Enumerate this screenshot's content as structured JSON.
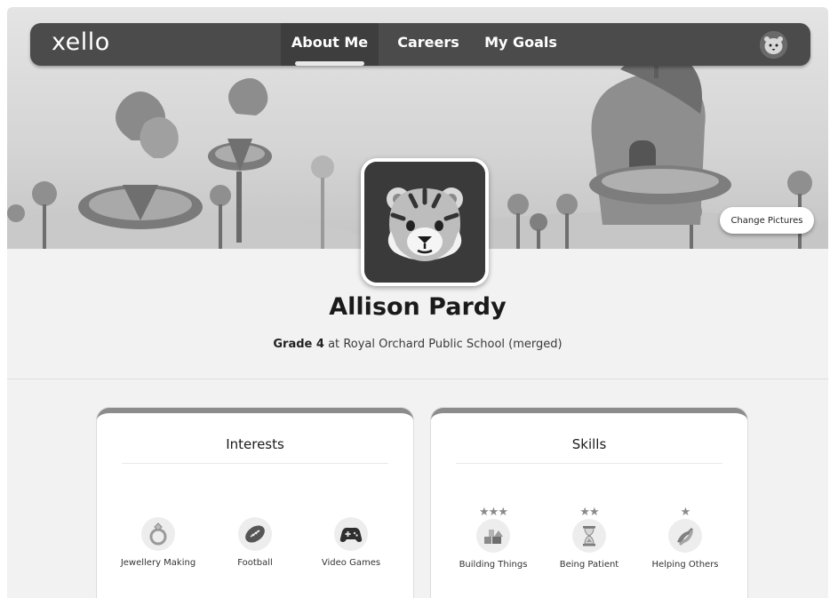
{
  "nav": {
    "logo": "xello",
    "tabs": [
      {
        "label": "About Me",
        "active": true
      },
      {
        "label": "Careers",
        "active": false
      },
      {
        "label": "My Goals",
        "active": false
      }
    ]
  },
  "banner": {
    "change_pictures_label": "Change Pictures"
  },
  "profile": {
    "name": "Allison Pardy",
    "grade": "Grade 4",
    "at": "at",
    "school": "Royal Orchard Public School (merged)",
    "avatar_icon": "tiger-icon"
  },
  "interests": {
    "title": "Interests",
    "items": [
      {
        "label": "Jewellery Making",
        "icon": "ring-icon"
      },
      {
        "label": "Football",
        "icon": "football-icon"
      },
      {
        "label": "Video Games",
        "icon": "gamepad-icon"
      }
    ]
  },
  "skills": {
    "title": "Skills",
    "items": [
      {
        "label": "Building Things",
        "icon": "building-blocks-icon",
        "stars": 3
      },
      {
        "label": "Being Patient",
        "icon": "hourglass-icon",
        "stars": 2
      },
      {
        "label": "Helping Others",
        "icon": "helping-hands-icon",
        "stars": 1
      }
    ]
  },
  "colors": {
    "nav_bg": "#4b4b4b",
    "card_accent": "#8c8c8c"
  }
}
